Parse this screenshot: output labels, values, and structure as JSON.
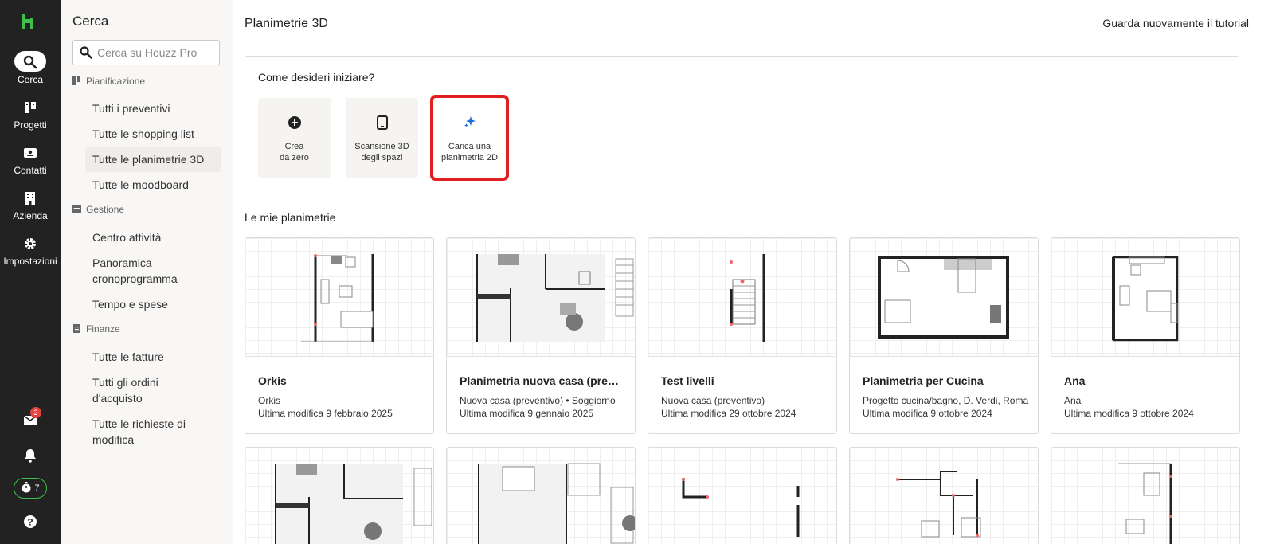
{
  "rail": {
    "items": [
      {
        "label": "Cerca",
        "icon": "search-icon"
      },
      {
        "label": "Progetti",
        "icon": "projects-icon"
      },
      {
        "label": "Contatti",
        "icon": "contacts-icon"
      },
      {
        "label": "Azienda",
        "icon": "building-icon"
      },
      {
        "label": "Impostazioni",
        "icon": "gear-icon"
      }
    ],
    "inbox_badge": "2",
    "timer_count": "7",
    "brand_color": "#3dbf4b"
  },
  "sidebar": {
    "title": "Cerca",
    "search_placeholder": "Cerca su Houzz Pro",
    "sections": [
      {
        "title": "Pianificazione",
        "items": [
          "Tutti i preventivi",
          "Tutte le shopping list",
          "Tutte le planimetrie 3D",
          "Tutte le moodboard"
        ]
      },
      {
        "title": "Gestione",
        "items": [
          "Centro attività",
          "Panoramica cronoprogramma",
          "Tempo e spese"
        ]
      },
      {
        "title": "Finanze",
        "items": [
          "Tutte le fatture",
          "Tutti gli ordini d'acquisto",
          "Tutte le richieste di modifica"
        ]
      }
    ],
    "active_item": "Tutte le planimetrie 3D"
  },
  "main": {
    "title": "Planimetrie 3D",
    "tutorial_link": "Guarda nuovamente il tutorial",
    "start": {
      "question": "Come desideri iniziare?",
      "options": [
        {
          "line1": "Crea",
          "line2": "da zero",
          "icon": "plus-circle-icon"
        },
        {
          "line1": "Scansione 3D",
          "line2": "degli spazi",
          "icon": "tablet-icon"
        },
        {
          "line1": "Carica una",
          "line2": "planimetria 2D",
          "icon": "sparkle-icon"
        }
      ]
    },
    "my_plans_title": "Le mie planimetrie",
    "cards": [
      {
        "name": "Orkis",
        "sub": "Orkis",
        "date": "Ultima modifica 9 febbraio 2025"
      },
      {
        "name": "Planimetria nuova casa (preventivo)",
        "sub": "Nuova casa (preventivo) • Soggiorno",
        "date": "Ultima modifica 9 gennaio 2025"
      },
      {
        "name": "Test livelli",
        "sub": "Nuova casa (preventivo)",
        "date": "Ultima modifica 29 ottobre 2024"
      },
      {
        "name": "Planimetria per Cucina",
        "sub": "Progetto cucina/bagno, D. Verdi, Roma",
        "date": "Ultima modifica 9 ottobre 2024"
      },
      {
        "name": "Ana",
        "sub": "Ana",
        "date": "Ultima modifica 9 ottobre 2024"
      }
    ],
    "highlight_color": "#e02020"
  }
}
